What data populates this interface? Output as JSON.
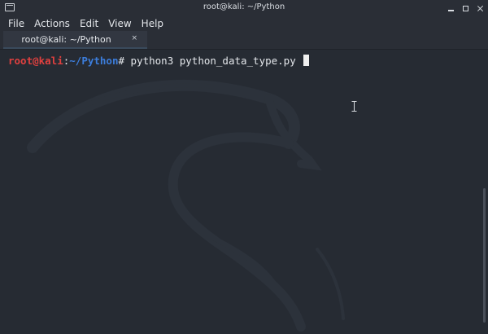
{
  "window": {
    "title": "root@kali: ~/Python"
  },
  "menubar": {
    "items": [
      "File",
      "Actions",
      "Edit",
      "View",
      "Help"
    ]
  },
  "tabs": [
    {
      "label": "root@kali: ~/Python",
      "close_glyph": "×"
    }
  ],
  "terminal": {
    "prompt_user_host": "root@kali",
    "prompt_separator": ":",
    "prompt_path": "~/Python",
    "prompt_symbol": "#",
    "command": " python3 python_data_type.py "
  },
  "colors": {
    "background": "#262b33",
    "prompt_user": "#e0403f",
    "prompt_path": "#3c7ddb",
    "text": "#e4e7eb"
  }
}
